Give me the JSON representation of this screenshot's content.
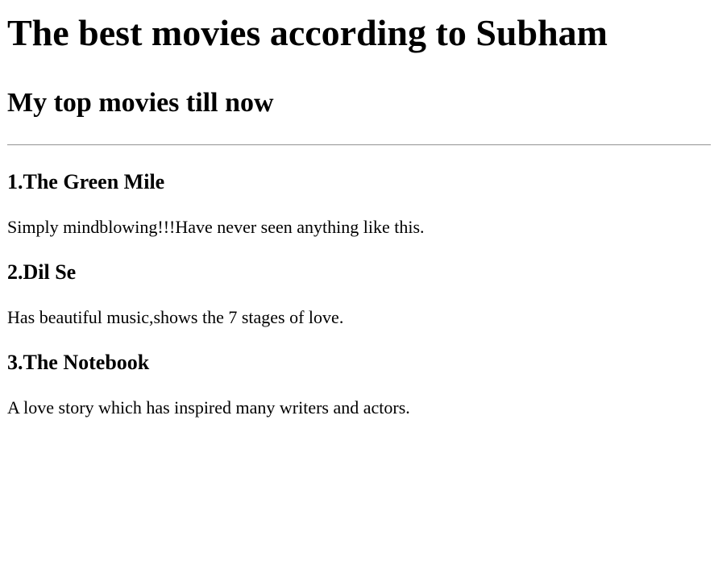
{
  "page": {
    "title": "The best movies according to Subham",
    "subtitle": "My top movies till now"
  },
  "movies": [
    {
      "title": "1.The Green Mile",
      "description": "Simply mindblowing!!!Have never seen anything like this."
    },
    {
      "title": "2.Dil Se",
      "description": "Has beautiful music,shows the 7 stages of love."
    },
    {
      "title": "3.The Notebook",
      "description": "A love story which has inspired many writers and actors."
    }
  ]
}
